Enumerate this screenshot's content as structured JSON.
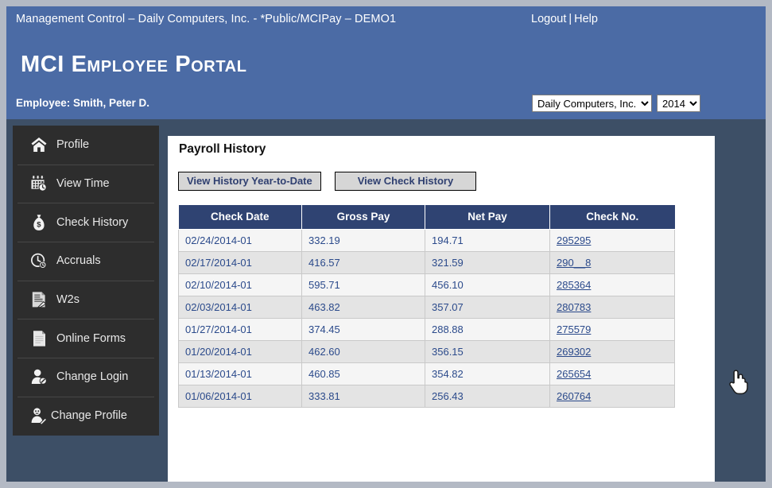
{
  "header": {
    "app_context": "Management Control – Daily Computers, Inc. - *Public/MCIPay – DEMO1",
    "logout_label": "Logout",
    "separator": "|",
    "help_label": "Help",
    "portal_title": "MCI Employee Portal",
    "employee_line": "Employee: Smith, Peter D.",
    "company_select": {
      "name": "company-select",
      "selected": "Daily Computers, Inc.",
      "options": [
        "Daily Computers, Inc."
      ]
    },
    "year_select": {
      "name": "year-select",
      "selected": "2014",
      "options": [
        "2014"
      ]
    }
  },
  "sidebar": {
    "items": [
      {
        "label": "Profile",
        "icon": "home-icon"
      },
      {
        "label": "View Time",
        "icon": "calendar-clock-icon"
      },
      {
        "label": "Check History",
        "icon": "money-bag-icon"
      },
      {
        "label": "Accruals",
        "icon": "clock-icon"
      },
      {
        "label": "W2s",
        "icon": "document-signature-icon"
      },
      {
        "label": "Online Forms",
        "icon": "page-icon"
      },
      {
        "label": "Change Login",
        "icon": "user-edit-icon"
      },
      {
        "label": "Change Profile",
        "icon": "user-pencil-icon"
      }
    ]
  },
  "main": {
    "panel_title": "Payroll History",
    "buttons": {
      "view_ytd": "View History Year-to-Date",
      "view_check_history": "View Check History"
    },
    "table": {
      "columns": [
        "Check Date",
        "Gross Pay",
        "Net Pay",
        "Check No."
      ],
      "rows": [
        {
          "check_date": "02/24/2014-01",
          "gross_pay": "332.19",
          "net_pay": "194.71",
          "check_no": "295295"
        },
        {
          "check_date": "02/17/2014-01",
          "gross_pay": "416.57",
          "net_pay": "321.59",
          "check_no": "290__8"
        },
        {
          "check_date": "02/10/2014-01",
          "gross_pay": "595.71",
          "net_pay": "456.10",
          "check_no": "285364"
        },
        {
          "check_date": "02/03/2014-01",
          "gross_pay": "463.82",
          "net_pay": "357.07",
          "check_no": "280783"
        },
        {
          "check_date": "01/27/2014-01",
          "gross_pay": "374.45",
          "net_pay": "288.88",
          "check_no": "275579"
        },
        {
          "check_date": "01/20/2014-01",
          "gross_pay": "462.60",
          "net_pay": "356.15",
          "check_no": "269302"
        },
        {
          "check_date": "01/13/2014-01",
          "gross_pay": "460.85",
          "net_pay": "354.82",
          "check_no": "265654"
        },
        {
          "check_date": "01/06/2014-01",
          "gross_pay": "333.81",
          "net_pay": "256.43",
          "check_no": "260764"
        }
      ]
    }
  },
  "cursor": {
    "icon": "hand-pointer-cursor"
  },
  "colors": {
    "header_blue": "#4b6ba5",
    "page_backdrop": "#3d4f66",
    "sidebar_dark": "#2d2d2d",
    "table_header_navy": "#2f4372",
    "link_blue": "#2b4a8b",
    "button_face": "#d6d6d6",
    "outer_frame": "#b3b9c4"
  }
}
